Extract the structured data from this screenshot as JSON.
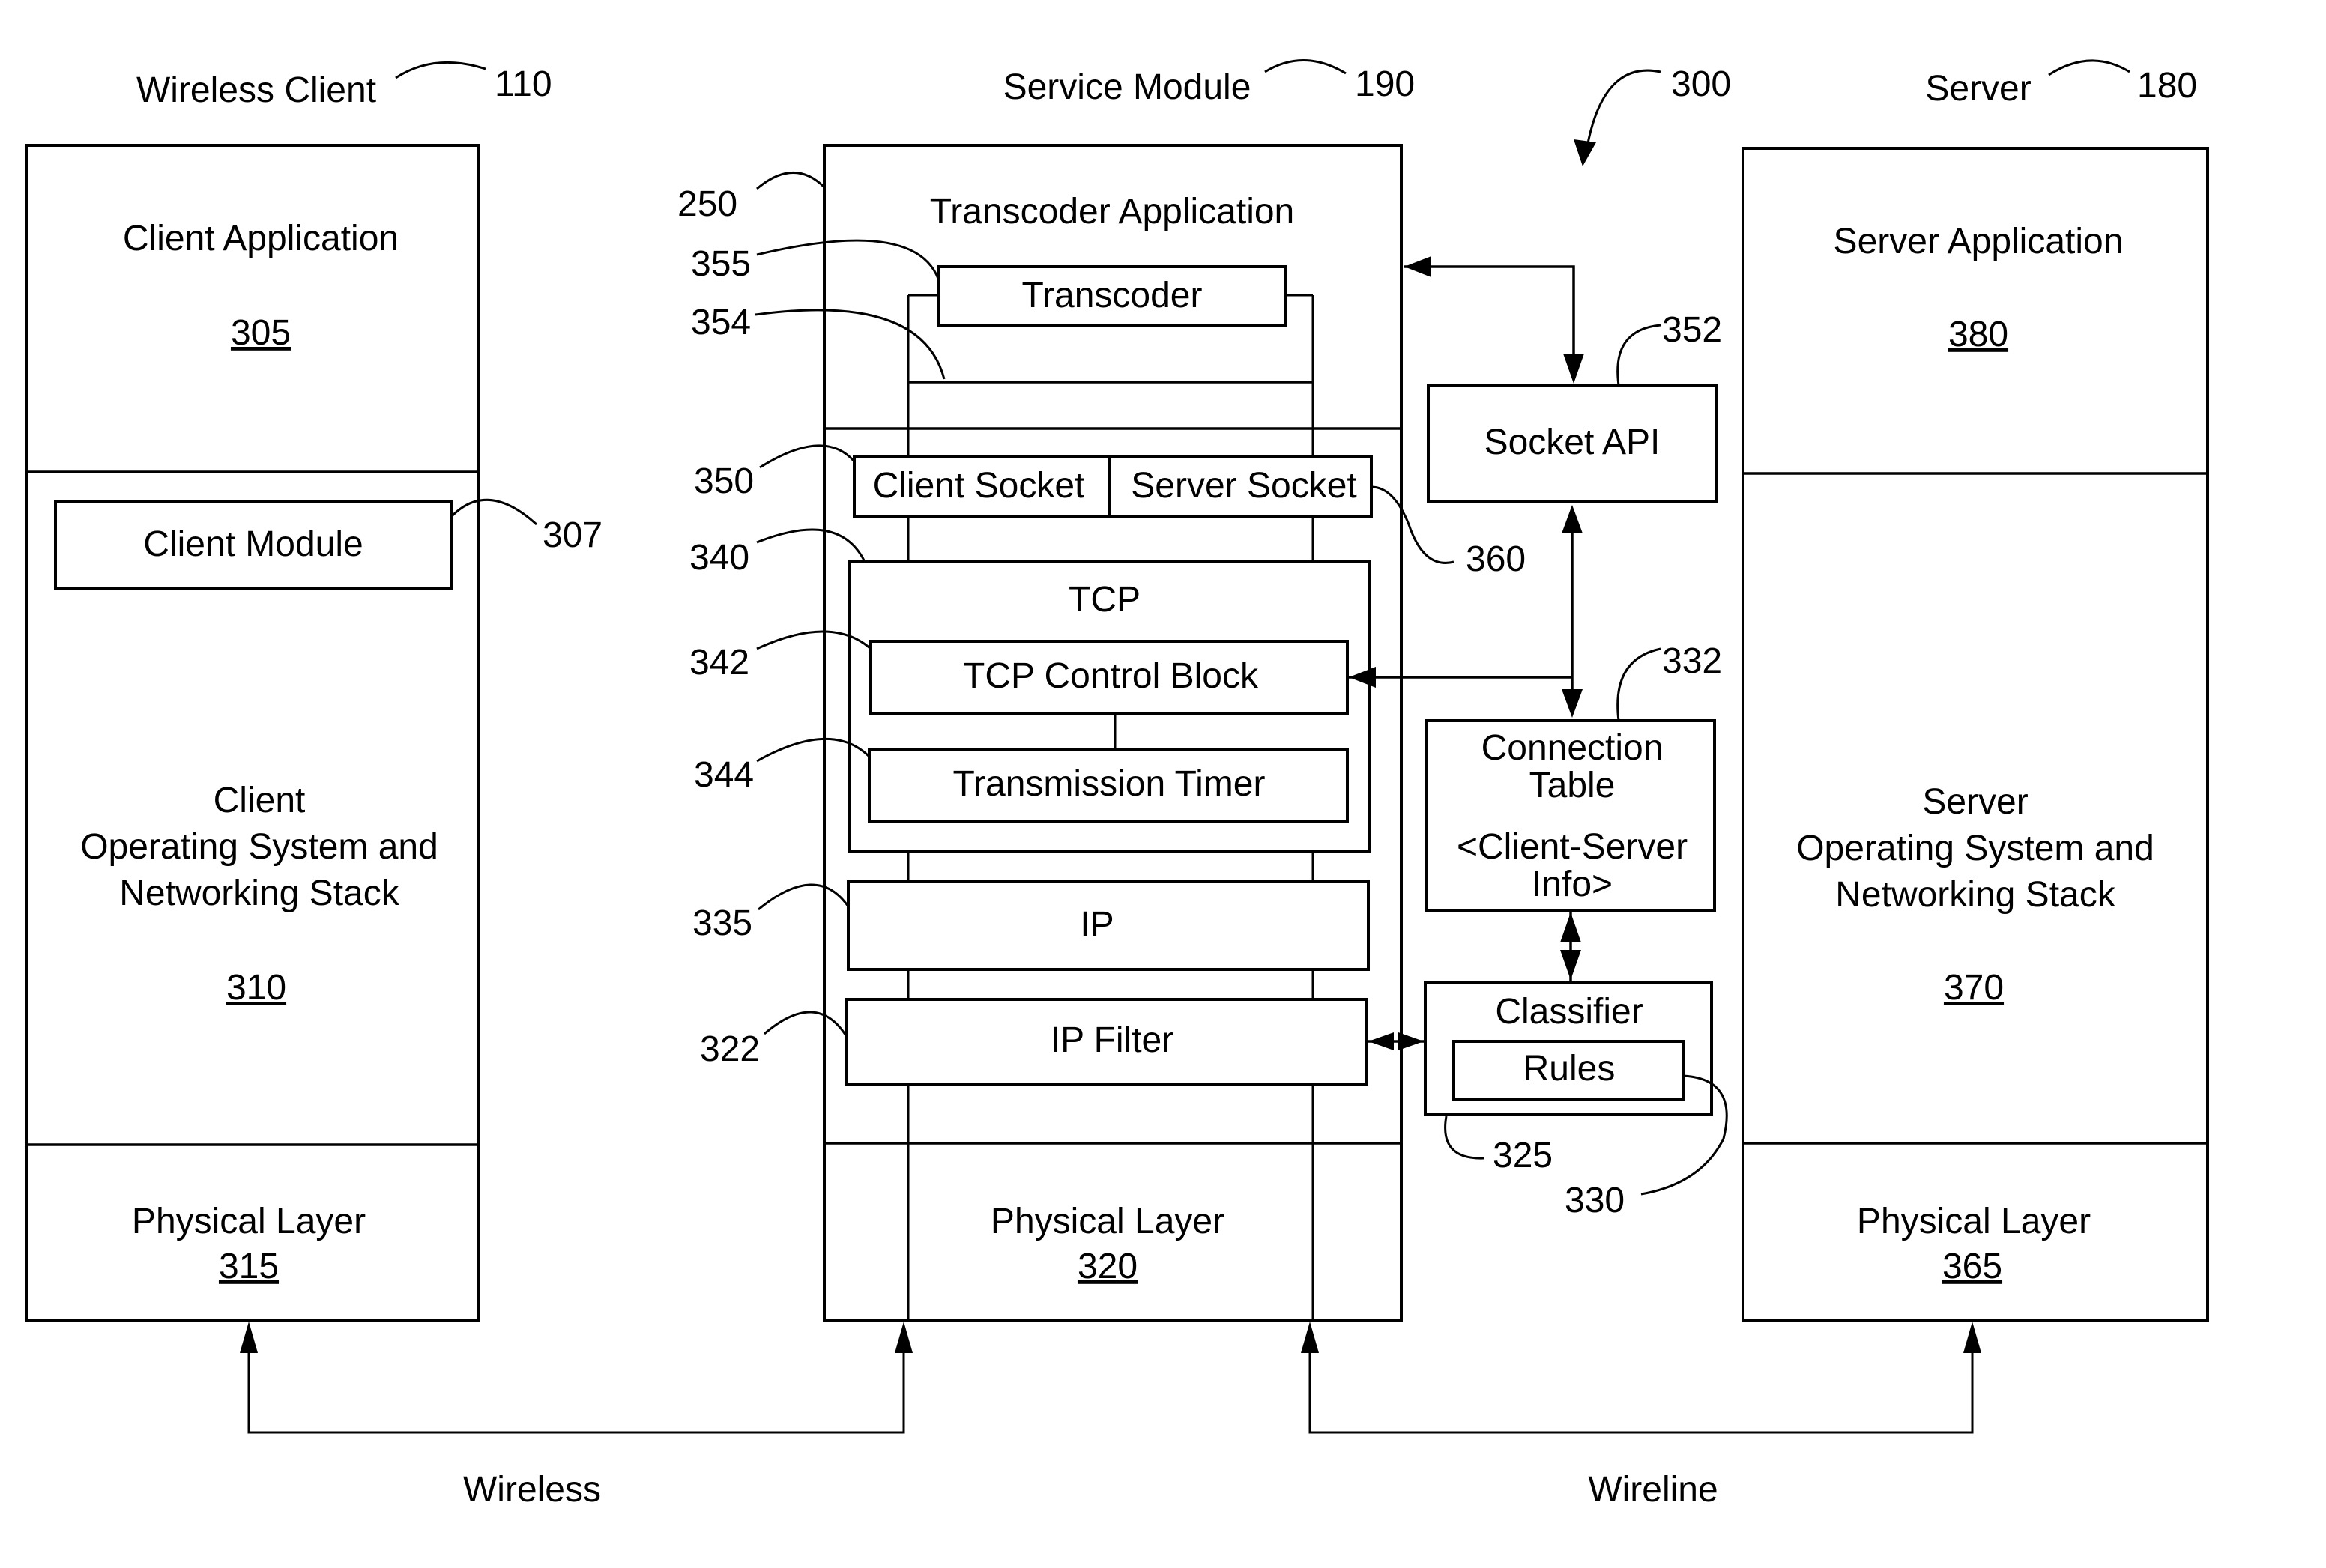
{
  "figure": {
    "figure_ref": "300",
    "colors": {
      "line": "#000000",
      "background": "#ffffff"
    }
  },
  "wireless_client": {
    "title": "Wireless Client",
    "ref": "110",
    "app": {
      "label": "Client Application",
      "ref": "305"
    },
    "module": {
      "label": "Client Module",
      "ref": "307"
    },
    "os": {
      "line1": "Client",
      "line2": "Operating System and",
      "line3": "Networking Stack",
      "ref": "310"
    },
    "phy": {
      "label": "Physical Layer",
      "ref": "315"
    }
  },
  "service_module": {
    "title": "Service Module",
    "ref": "190",
    "outer_ref": "250",
    "app": {
      "label": "Transcoder Application"
    },
    "transcoder": {
      "label": "Transcoder",
      "ref": "355"
    },
    "pipe_ref": "354",
    "client_socket": {
      "label": "Client Socket",
      "ref": "350"
    },
    "server_socket": {
      "label": "Server Socket",
      "ref": "360"
    },
    "tcp": {
      "label": "TCP",
      "ref": "340"
    },
    "tcb": {
      "label": "TCP Control Block",
      "ref": "342"
    },
    "timer": {
      "label": "Transmission Timer",
      "ref": "344"
    },
    "ip": {
      "label": "IP",
      "ref": "335"
    },
    "ip_filter": {
      "label": "IP Filter",
      "ref": "322"
    },
    "phy": {
      "label": "Physical Layer",
      "ref": "320"
    }
  },
  "middle": {
    "socket_api": {
      "label": "Socket API",
      "ref": "352"
    },
    "conn_table": {
      "line1": "Connection",
      "line2": "Table",
      "line3": "<Client-Server",
      "line4": "Info>",
      "ref": "332"
    },
    "classifier": {
      "label": "Classifier",
      "ref": "325"
    },
    "rules": {
      "label": "Rules",
      "ref": "330"
    }
  },
  "server": {
    "title": "Server",
    "ref": "180",
    "app": {
      "label": "Server Application",
      "ref": "380"
    },
    "os": {
      "line1": "Server",
      "line2": "Operating System and",
      "line3": "Networking Stack",
      "ref": "370"
    },
    "phy": {
      "label": "Physical Layer",
      "ref": "365"
    }
  },
  "links": {
    "wireless": "Wireless",
    "wireline": "Wireline"
  }
}
